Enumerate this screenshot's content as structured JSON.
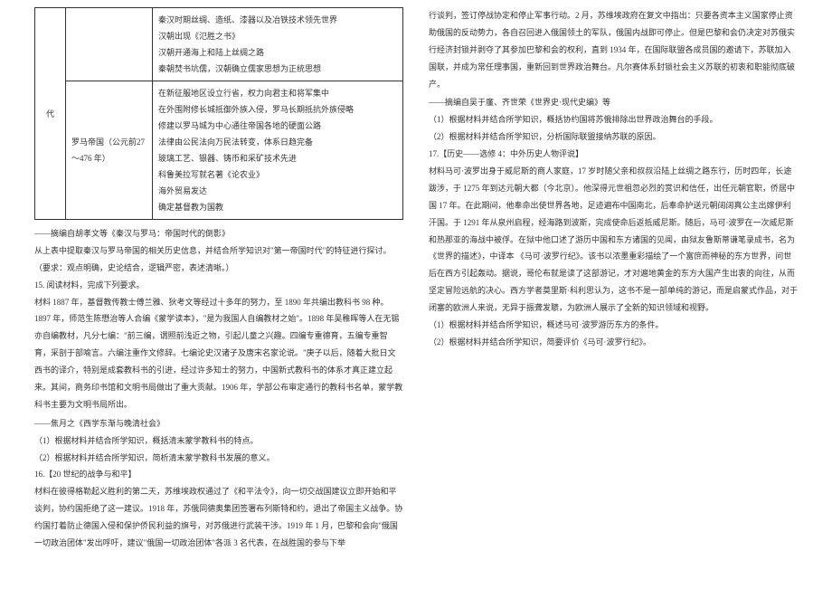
{
  "table": {
    "row1": {
      "col1": "代",
      "col2": "",
      "lines": [
        "秦汉时期丝绸、造纸、漆器以及冶铁技术领先世界",
        "汉朝出现《氾胜之书》",
        "汉朝开通海上和陆上丝绸之路",
        "秦朝焚书坑儒，汉朝确立儒家思想为正统思想"
      ]
    },
    "row2": {
      "col2": "罗马帝国（公元前27～476 年）",
      "lines": [
        "在新征服地区设立行省，权力向君主和将军集中",
        "在外围附修长城抵御外族入侵，罗马长期抵抗外族侵略",
        "修建以罗马城为中心通往帝国各地的硬面公路",
        "法律由公民法向万民法转变，体系日趋完备",
        "玻璃工艺、银器、铸币和采矿技术先进",
        "科鲁美拉写就名著《论农业》",
        "海外贸易发达",
        "确定基督教为国教"
      ]
    }
  },
  "left": {
    "p1": "——摘编自胡孝文等《秦汉与罗马：帝国时代的倒影》",
    "p2": "从上表中提取秦汉与罗马帝国的相关历史信息，并结合所学知识对\"第一帝国时代\"的特征进行探讨。",
    "p3": "（要求：观点明确，史论结合，逻辑严密，表述清晰。）",
    "p4": "15. 阅读材料，完成下列要求。",
    "p5": "材料 1887 年，基督教传教士傅兰雅、狄考文等经过十多年的努力，至 1890 年共编出教科书 98 种。1897 年，师范生陈懋治等人合编《蒙学读本》，\"是为我国人自编教材之始\"。1898 年吴稚晖等人在无锡亦自编教材，凡分七编：\"前三编，谓照前浅近之物，引起儿童之兴趣。四编专重德育，五编专重智育，采剖于部喻言。六编注重作文修辞。七编论史汉诸子及唐宋名家论说。\"庚子以后，随着大批日文西书的译介，特别是成套教科书的引进，经过许多知士的努力，中国新式教科书的体系才真正建立起来。其间，商务印书馆和文明书局做出了重大贡献。1906 年，学部公布审定通行的教科书名单，蒙学教科书主要为文明书局所出。",
    "p6": "——焦月之《西学东渐与晚清社会》",
    "p7": "（1）根据材料并结合所学知识，概括清末蒙学教科书的特点。",
    "p8": "（2）根据材料并结合所学知识，简析清末蒙学教科书发展的意义。",
    "p9": "16.【20 世纪的战争与和平】",
    "p10": "材料在彼得格勒起义胜利的第二天，苏维埃政权通过了《和平法令》，向一切交战国建议立即开始和平谈判，协约国拒绝了这一建议。1918 年，苏俄同德奥集团签署布列斯特和约，退出了帝国主义战争。协约国打着防止德国入侵和保护侨民利益的旗号，对苏俄进行武装干涉。1919 年 1 月，巴黎和会向\"俄国一切政治团体\"发出呼吁，建议\"俄国一切政治团体\"各派 3 名代表，在战胜国的参与下举"
  },
  "right": {
    "p1": "行谈判，签订停战协定和停止军事行动。2 月，苏维埃政府在复文中指出：只要各资本主义国家停止资助俄国的反动势力，各自召回进入俄国领土的军队，俄国内战即可停止。但是巴黎和会仍决定对苏俄实行经济封锁并剥夺了其参加巴黎和会的权利，直到 1934 年，在国际联盟各成员国的邀请下，苏联加入国联，并成为常任理事国，重新回到世界政治舞台。凡尔赛体系封锁社会主义苏联的初衷和职能彻底破产。",
    "p2": "——摘编自吴于廑、齐世荣《世界史·现代史编》等",
    "p3": "（1）根据材料并结合所学知识，概括协约国将苏俄排除出世界政治舞台的手段。",
    "p4": "（2）根据材料并结合所学知识，分析国际联盟接纳苏联的原因。",
    "p5": "17.【历史——选修 4：中外历史人物评说】",
    "p6": "材料马可·波罗出身于威尼斯的商人家庭，17 岁时随父亲和叔叔沿陆上丝绸之路东行，历时四年，长途跋涉，于 1275 年到达元朝大都（今北京）。他深得元世祖忽必烈的赏识和信任，出任元朝官职，侨居中国 17 年。在此期间，他奉命出使世界各地，足迹遍布中国南北，后奉命护送元朝阔阔真公主出嫁伊利汗国。于 1291 年从泉州启程，经海路到波斯，完成使命后返抵威尼斯。随后，马可·波罗在一次威尼斯和热那亚的海战中被俘。在狱中他口述了游历中国和东方诸国的见闻，由狱友鲁斯蒂谦笔录成书，名为《世界的描述》，中译本 《马可·波罗行纪》。该书以浓墨重彩描绘了一个富庶而神秘的东方世界，问世后在西方引起轰动。据说，哥伦布就是读了这部游记，才对遍地黄金的东方大国产生出衷的向往，从而坚定冒险远航的决心。西方学者莫里斯·科利思认为，这书不是一部单纯的游记，而是启蒙式作品，对于闭塞的欧洲人来说，无异于振聋发聩，为欧洲人展示了全新的知识领域和视野。",
    "p7": "（1）根据材料并结合所学知识，概述马可·波罗游历东方的条件。",
    "p8": "（2）根据材料并结合所学知识，简要评价《马可·波罗行纪》。"
  }
}
